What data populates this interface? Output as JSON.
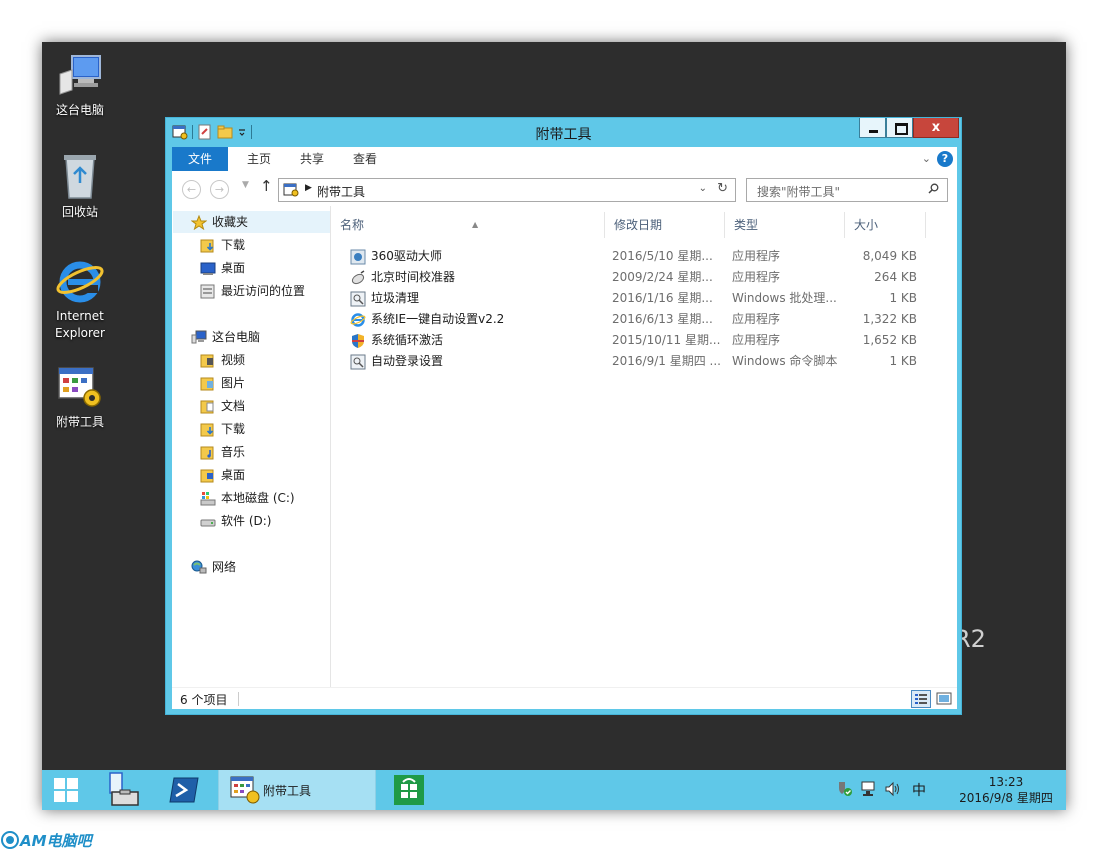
{
  "desktop": {
    "icons": [
      {
        "label": "这台电脑",
        "icon": "computer-icon"
      },
      {
        "label": "回收站",
        "icon": "recycle-bin-icon"
      },
      {
        "label": "Internet Explorer",
        "icon": "internet-explorer-icon"
      },
      {
        "label": "附带工具",
        "icon": "tools-folder-icon"
      }
    ],
    "watermark_fragment": "R2"
  },
  "window": {
    "title": "附带工具",
    "close_label": "x",
    "ribbon_tabs": [
      "文件",
      "主页",
      "共享",
      "查看"
    ],
    "help_label": "?",
    "address": {
      "path": "附带工具"
    },
    "search": {
      "placeholder": "搜索\"附带工具\""
    },
    "nav": {
      "favorites": {
        "label": "收藏夹",
        "items": [
          "下载",
          "桌面",
          "最近访问的位置"
        ]
      },
      "this_pc": {
        "label": "这台电脑",
        "items": [
          "视频",
          "图片",
          "文档",
          "下载",
          "音乐",
          "桌面",
          "本地磁盘 (C:)",
          "软件 (D:)"
        ]
      },
      "network": {
        "label": "网络"
      }
    },
    "columns": {
      "name": "名称",
      "date": "修改日期",
      "type": "类型",
      "size": "大小"
    },
    "files": [
      {
        "name": "360驱动大师",
        "date": "2016/5/10 星期...",
        "type": "应用程序",
        "size": "8,049 KB",
        "icon": "app-360-icon"
      },
      {
        "name": "北京时间校准器",
        "date": "2009/2/24 星期...",
        "type": "应用程序",
        "size": "264 KB",
        "icon": "clock-sync-icon"
      },
      {
        "name": "垃圾清理",
        "date": "2016/1/16 星期...",
        "type": "Windows 批处理...",
        "size": "1 KB",
        "icon": "batch-file-icon"
      },
      {
        "name": "系统IE一键自动设置v2.2",
        "date": "2016/6/13 星期...",
        "type": "应用程序",
        "size": "1,322 KB",
        "icon": "ie-setup-icon"
      },
      {
        "name": "系统循环激活",
        "date": "2015/10/11 星期...",
        "type": "应用程序",
        "size": "1,652 KB",
        "icon": "shield-app-icon"
      },
      {
        "name": "自动登录设置",
        "date": "2016/9/1 星期四 ...",
        "type": "Windows 命令脚本",
        "size": "1 KB",
        "icon": "cmd-script-icon"
      }
    ],
    "status": {
      "item_count": "6 个项目"
    }
  },
  "taskbar": {
    "active_window_label": "附带工具",
    "ime": "中",
    "time": "13:23",
    "date": "2016/9/8 星期四"
  },
  "brand": {
    "logo_text": "AM电脑吧",
    "accent": "#1f8fc8"
  },
  "colors": {
    "window_frame": "#5fc8e8",
    "file_tab": "#1979ca",
    "close_button": "#c7463c",
    "desktop": "#2d2d2d"
  }
}
